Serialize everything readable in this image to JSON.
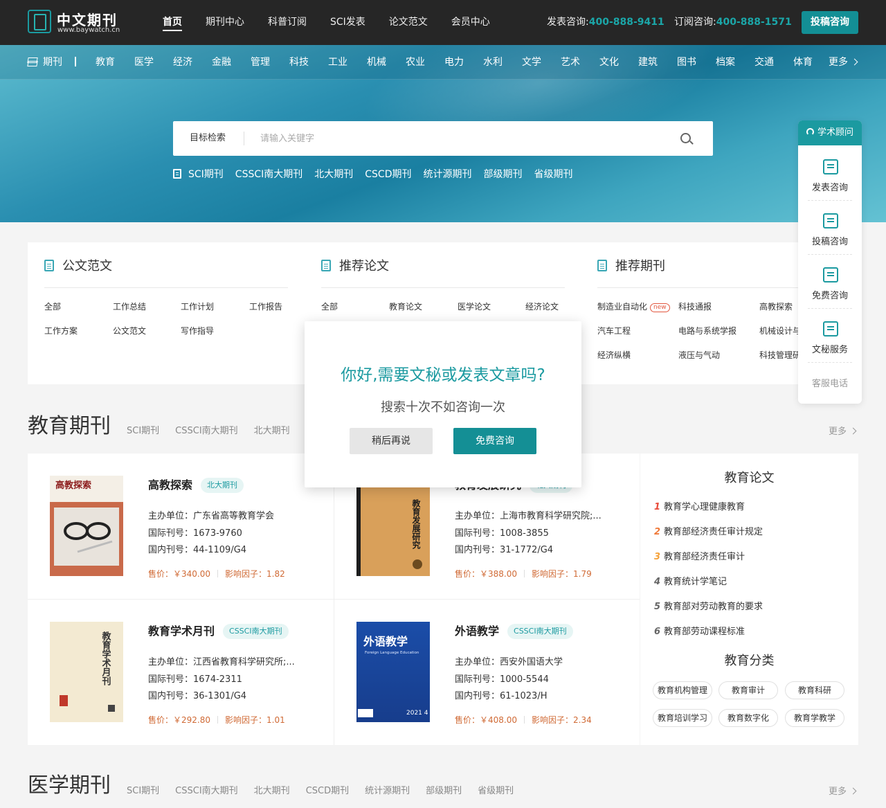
{
  "header": {
    "logo_title": "中文期刊",
    "logo_url": "www.baywatch.cn",
    "nav": [
      "首页",
      "期刊中心",
      "科普订阅",
      "SCI发表",
      "论文范文",
      "会员中心"
    ],
    "publish_label": "发表咨询:",
    "publish_phone": "400-888-9411",
    "subscribe_label": "订阅咨询:",
    "subscribe_phone": "400-888-1571",
    "submit_button": "投稿咨询"
  },
  "catnav": {
    "lead": "期刊",
    "items": [
      "教育",
      "医学",
      "经济",
      "金融",
      "管理",
      "科技",
      "工业",
      "机械",
      "农业",
      "电力",
      "水利",
      "文学",
      "艺术",
      "文化",
      "建筑",
      "图书",
      "档案",
      "交通",
      "体育"
    ],
    "more": "更多"
  },
  "search": {
    "scope": "目标检索",
    "placeholder": "请输入关键字",
    "tags": [
      "SCI期刊",
      "CSSCI南大期刊",
      "北大期刊",
      "CSCD期刊",
      "统计源期刊",
      "部级期刊",
      "省级期刊"
    ]
  },
  "panels": {
    "official": {
      "title": "公文范文",
      "links": [
        "全部",
        "工作总结",
        "工作计划",
        "工作报告",
        "工作方案",
        "公文范文",
        "写作指导"
      ]
    },
    "papers": {
      "title": "推荐论文",
      "links": [
        "全部",
        "教育论文",
        "医学论文",
        "经济论文"
      ]
    },
    "journals": {
      "title": "推荐期刊",
      "new_badge": "new",
      "links": [
        "制造业自动化",
        "科技通报",
        "高教探索",
        "汽车工程",
        "电路与系统学报",
        "机械设计与",
        "经济纵横",
        "液压与气动",
        "科技管理研"
      ]
    }
  },
  "education": {
    "title": "教育期刊",
    "tabs": [
      "SCI期刊",
      "CSSCI南大期刊",
      "北大期刊"
    ],
    "more": "更多",
    "journals": [
      {
        "name": "高教探索",
        "badge": "北大期刊",
        "sponsor": "主办单位：广东省高等教育学会",
        "issn": "国际刊号：1673-9760",
        "cn": "国内刊号：44-1109/G4",
        "price": "售价：￥340.00",
        "impact": "影响因子：1.82",
        "cover_title": "高教探索"
      },
      {
        "name": "教育发展研究",
        "badge": "北大期刊",
        "sponsor": "主办单位：上海市教育科学研究院;...",
        "issn": "国际刊号：1008-3855",
        "cn": "国内刊号：31-1772/G4",
        "price": "售价：￥388.00",
        "impact": "影响因子：1.79",
        "cover_title": "教育发展研究"
      },
      {
        "name": "教育学术月刊",
        "badge": "CSSCI南大期刊",
        "sponsor": "主办单位：江西省教育科学研究所;...",
        "issn": "国际刊号：1674-2311",
        "cn": "国内刊号：36-1301/G4",
        "price": "售价：￥292.80",
        "impact": "影响因子：1.01",
        "cover_title": "教育学术月刊"
      },
      {
        "name": "外语教学",
        "badge": "CSSCI南大期刊",
        "sponsor": "主办单位：西安外国语大学",
        "issn": "国际刊号：1000-5544",
        "cn": "国内刊号：61-1023/H",
        "price": "售价：￥408.00",
        "impact": "影响因子：2.34",
        "cover_title": "外语教学",
        "cover_sub": "Foreign Language Education",
        "cover_year": "2021 4"
      }
    ],
    "papers_title": "教育论文",
    "papers": [
      "教育学心理健康教育",
      "教育部经济责任审计规定",
      "教育部经济责任审计",
      "教育统计学笔记",
      "教育部对劳动教育的要求",
      "教育部劳动课程标准"
    ],
    "rank_colors": [
      "#e84b3a",
      "#f07a3a",
      "#f5a23a",
      "#666666",
      "#666666",
      "#666666"
    ],
    "categories_title": "教育分类",
    "categories": [
      "教育机构管理",
      "教育审计",
      "教育科研",
      "教育培训学习",
      "教育数字化",
      "教育学教学"
    ]
  },
  "medical": {
    "title": "医学期刊",
    "tabs": [
      "SCI期刊",
      "CSSCI南大期刊",
      "北大期刊",
      "CSCD期刊",
      "统计源期刊",
      "部级期刊",
      "省级期刊"
    ],
    "more": "更多"
  },
  "sidebar": {
    "head": "学术顾问",
    "items": [
      "发表咨询",
      "投稿咨询",
      "免费咨询",
      "文秘服务"
    ],
    "phone": "客服电话"
  },
  "modal": {
    "title": "你好,需要文秘或发表文章吗?",
    "subtitle": "搜索十次不如咨询一次",
    "later": "稍后再说",
    "consult": "免费咨询"
  }
}
